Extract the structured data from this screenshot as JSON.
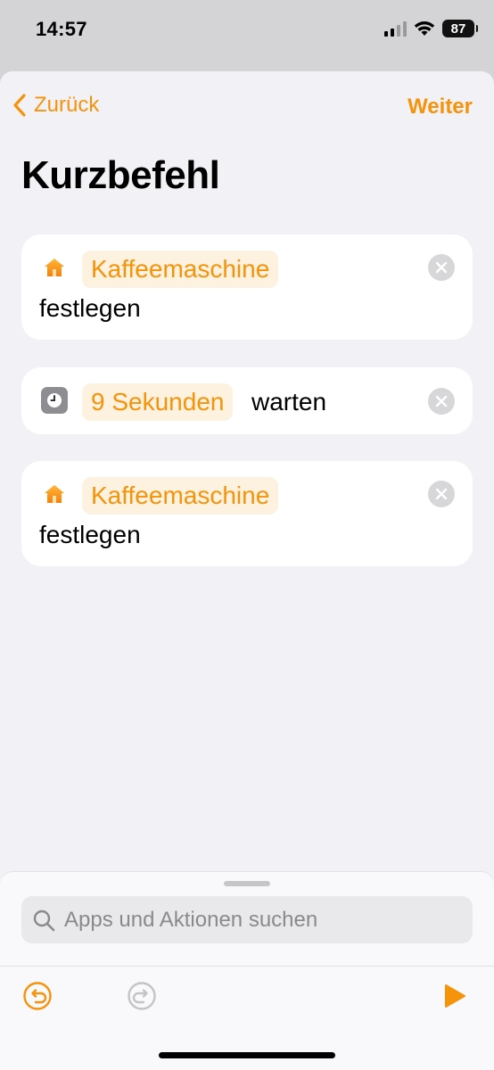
{
  "status_bar": {
    "time": "14:57",
    "battery_level": "87",
    "signal_bars": 2,
    "signal_bars_total": 4,
    "icons": [
      "cellular-signal-icon",
      "wifi-icon",
      "battery-icon"
    ]
  },
  "nav": {
    "back_label": "Zurück",
    "next_label": "Weiter"
  },
  "page": {
    "title": "Kurzbefehl"
  },
  "actions": [
    {
      "icon": "home-icon",
      "token": "Kaffeemaschine",
      "text": "festlegen"
    },
    {
      "icon": "clock-icon",
      "token": "9 Sekunden",
      "text": "warten"
    },
    {
      "icon": "home-icon",
      "token": "Kaffeemaschine",
      "text": "festlegen"
    }
  ],
  "search": {
    "placeholder": "Apps und Aktionen suchen"
  },
  "toolbar": {
    "undo": "undo-icon",
    "redo": "redo-icon",
    "play": "play-icon"
  },
  "colors": {
    "accent": "#f5930a",
    "token_background": "#fdf1e0",
    "sheet_background": "#f2f1f6",
    "card_background": "#ffffff"
  }
}
